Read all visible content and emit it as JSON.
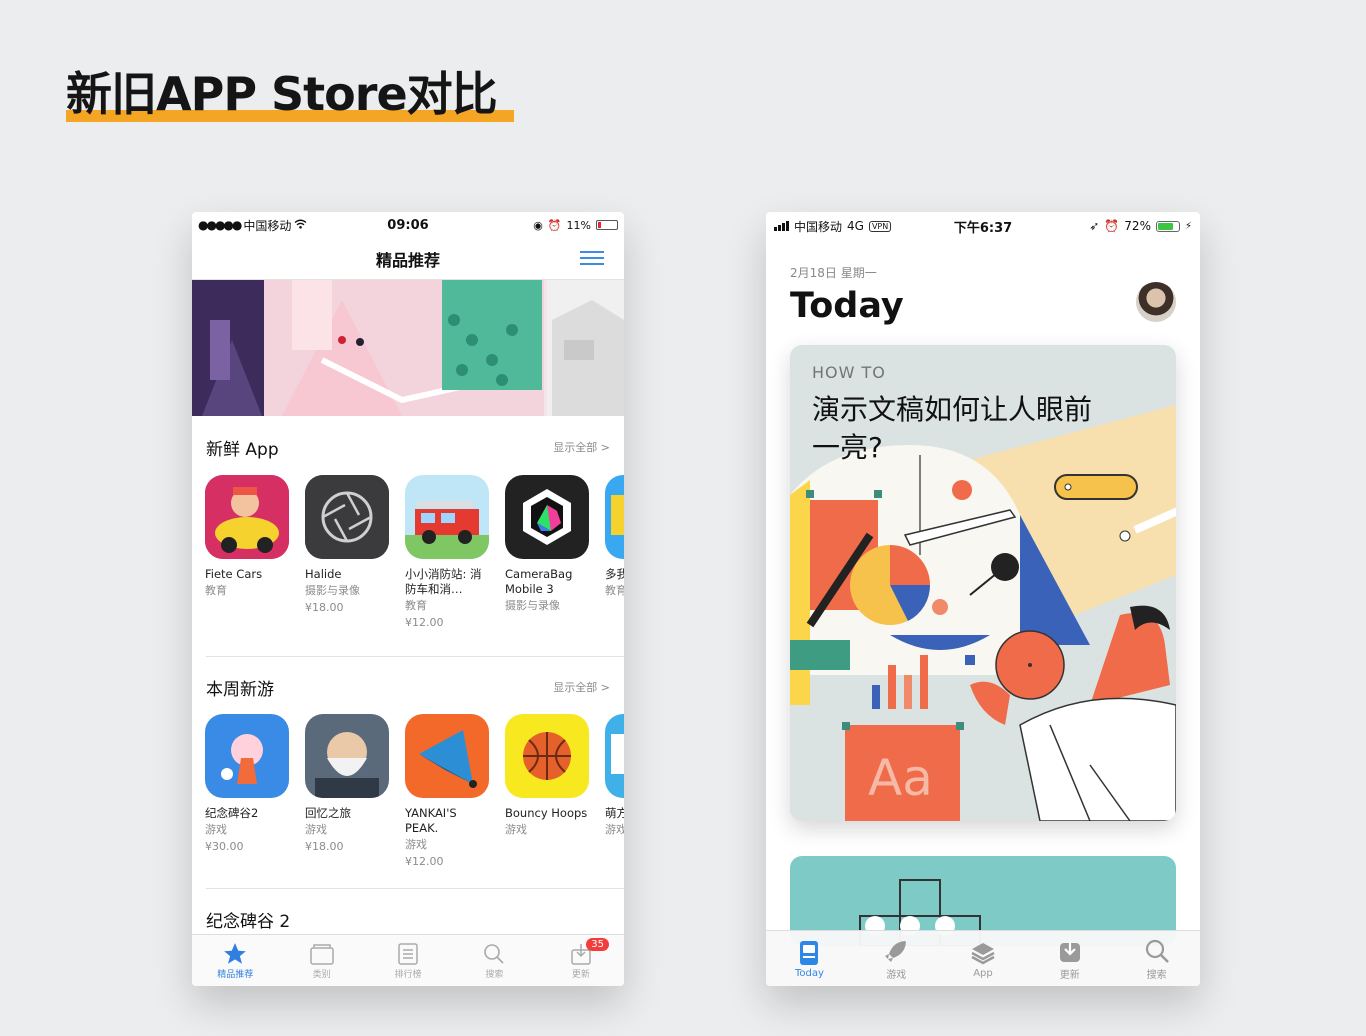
{
  "heading": {
    "title": "新旧APP Store对比",
    "underline_color": "#f5a524"
  },
  "old_phone": {
    "status": {
      "carrier": "中国移动",
      "time": "09:06",
      "battery": "11%"
    },
    "nav_title": "精品推荐",
    "sections": [
      {
        "title": "新鲜 App",
        "see_all": "显示全部 >",
        "apps": [
          {
            "name": "Fiete Cars",
            "category": "教育",
            "price": ""
          },
          {
            "name": "Halide",
            "category": "摄影与录像",
            "price": "¥18.00"
          },
          {
            "name": "小小消防站: 消防车和消…",
            "category": "教育",
            "price": "¥12.00"
          },
          {
            "name": "CameraBag Mobile 3",
            "category": "摄影与录像",
            "price": ""
          },
          {
            "name": "多我 动画",
            "category": "教育",
            "price": ""
          }
        ]
      },
      {
        "title": "本周新游",
        "see_all": "显示全部 >",
        "apps": [
          {
            "name": "纪念碑谷2",
            "category": "游戏",
            "price": "¥30.00"
          },
          {
            "name": "回忆之旅",
            "category": "游戏",
            "price": "¥18.00"
          },
          {
            "name": "YANKAI'S PEAK.",
            "category": "游戏",
            "price": "¥12.00"
          },
          {
            "name": "Bouncy Hoops",
            "category": "游戏",
            "price": ""
          },
          {
            "name": "萌方",
            "category": "游戏",
            "price": ""
          }
        ]
      }
    ],
    "next_section_title": "纪念碑谷 2",
    "tabs": [
      {
        "label": "精品推荐",
        "icon": "star-icon",
        "active": true
      },
      {
        "label": "类别",
        "icon": "category-icon",
        "active": false
      },
      {
        "label": "排行榜",
        "icon": "list-icon",
        "active": false
      },
      {
        "label": "搜索",
        "icon": "search-icon",
        "active": false
      },
      {
        "label": "更新",
        "icon": "update-icon",
        "active": false,
        "badge": "35"
      }
    ]
  },
  "new_phone": {
    "status": {
      "carrier": "中国移动",
      "network": "4G",
      "vpn": "VPN",
      "time": "下午6:37",
      "battery": "72%"
    },
    "date": "2月18日 星期一",
    "title": "Today",
    "card": {
      "kicker": "HOW TO",
      "title": "演示文稿如何让人眼前一亮?",
      "illustration_text": "Aa"
    },
    "tabs": [
      {
        "label": "Today",
        "icon": "today-icon",
        "active": true
      },
      {
        "label": "游戏",
        "icon": "rocket-icon",
        "active": false
      },
      {
        "label": "App",
        "icon": "layers-icon",
        "active": false
      },
      {
        "label": "更新",
        "icon": "download-icon",
        "active": false
      },
      {
        "label": "搜索",
        "icon": "search-icon",
        "active": false
      }
    ]
  }
}
